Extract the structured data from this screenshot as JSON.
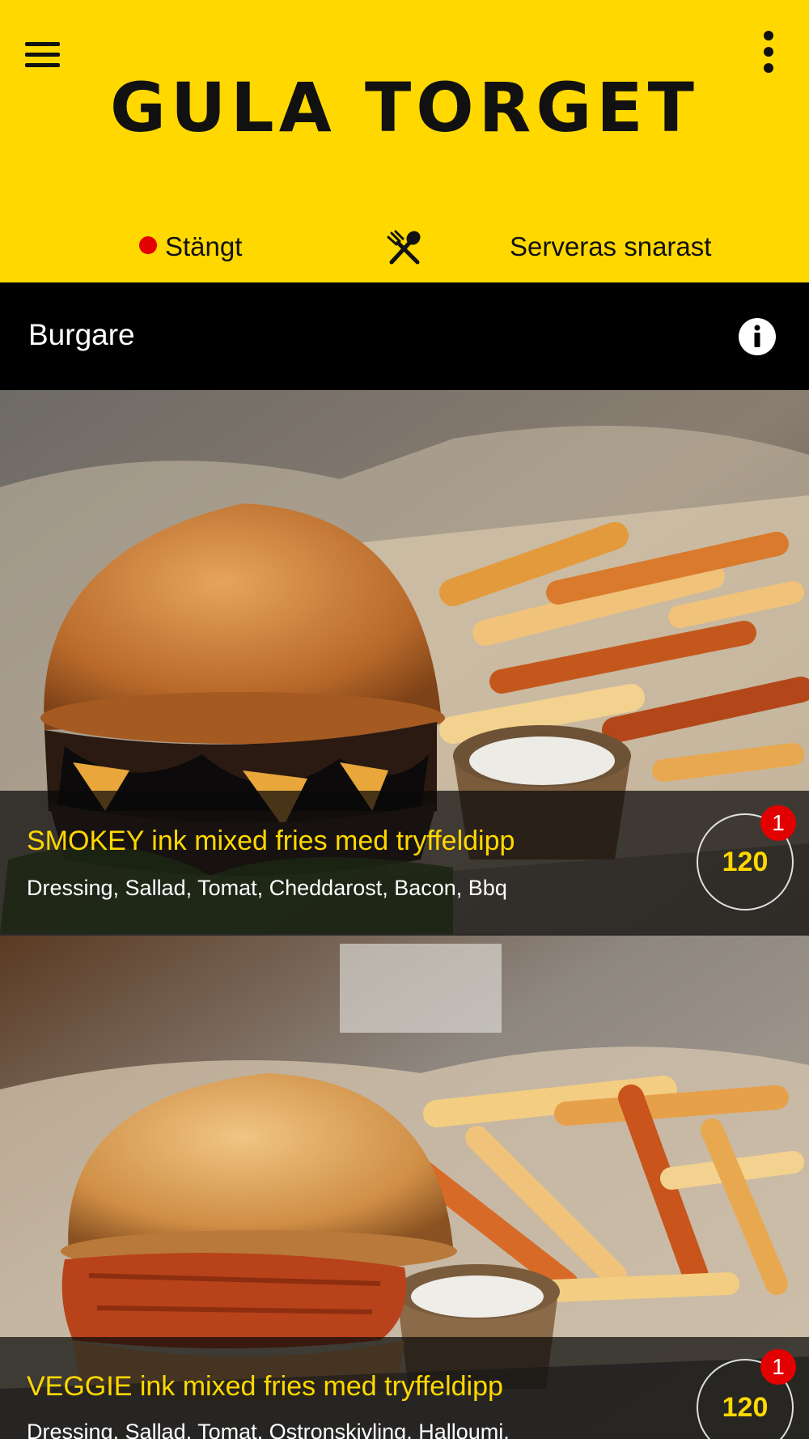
{
  "header": {
    "brand": "GULA TORGET",
    "status_label": "Stängt",
    "serve_label": "Serveras snarast",
    "status_color": "#e30000",
    "brand_color": "#FFD800"
  },
  "icons": {
    "menu": "hamburger-menu-icon",
    "more": "more-vertical-icon",
    "cutlery": "cutlery-icon",
    "info": "info-icon"
  },
  "category": {
    "title": "Burgare"
  },
  "products": [
    {
      "name": "SMOKEY ink mixed fries med tryffeldipp",
      "description": "Dressing, Sallad, Tomat, Cheddarost, Bacon, Bbq",
      "price": "120",
      "badge": "1"
    },
    {
      "name": "VEGGIE ink mixed fries med tryffeldipp",
      "description": "Dressing, Sallad, Tomat, Ostronskivling, Halloumi,",
      "price": "120",
      "badge": "1"
    }
  ]
}
